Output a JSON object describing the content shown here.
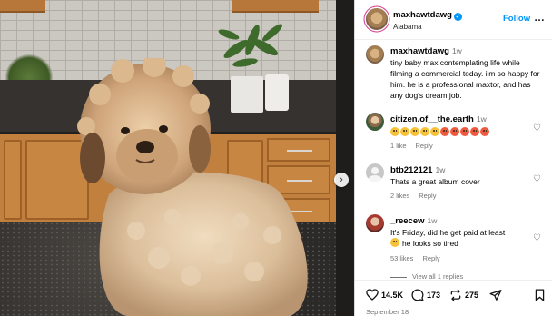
{
  "post": {
    "image_alt": "Fluffy dog sitting on a kitchen counter",
    "next_icon": "chevron-right-icon"
  },
  "header": {
    "username": "maxhawtdawg",
    "verified_icon": "verified-badge-icon",
    "location": "Alabama",
    "follow_label": "Follow",
    "more_label": "…"
  },
  "caption": {
    "username": "maxhawtdawg",
    "time": "1w",
    "text": "tiny baby max contemplating life while filming a commercial today. i'm so happy for him. he is a professional maxtor, and has any dog's dream job."
  },
  "comments": [
    {
      "username": "citizen.of__the.earth",
      "time": "1w",
      "text": "",
      "emoji_count": 10,
      "likes": "1 like",
      "reply_label": "Reply"
    },
    {
      "username": "btb212121",
      "time": "1w",
      "text": "Thats a great album cover",
      "likes": "2 likes",
      "reply_label": "Reply"
    },
    {
      "username": "_reecew",
      "time": "1w",
      "text": "It's Friday, did he get paid at least",
      "text2": "he looks so tired",
      "likes": "53 likes",
      "reply_label": "Reply"
    }
  ],
  "view_replies": "View all 1 replies",
  "actions": {
    "likes": "14.5K",
    "comments": "173",
    "shares": "275"
  },
  "date": "September 18",
  "colors": {
    "accent": "#0095f6",
    "story_ring": "#d33c8c",
    "muted": "#737373"
  }
}
